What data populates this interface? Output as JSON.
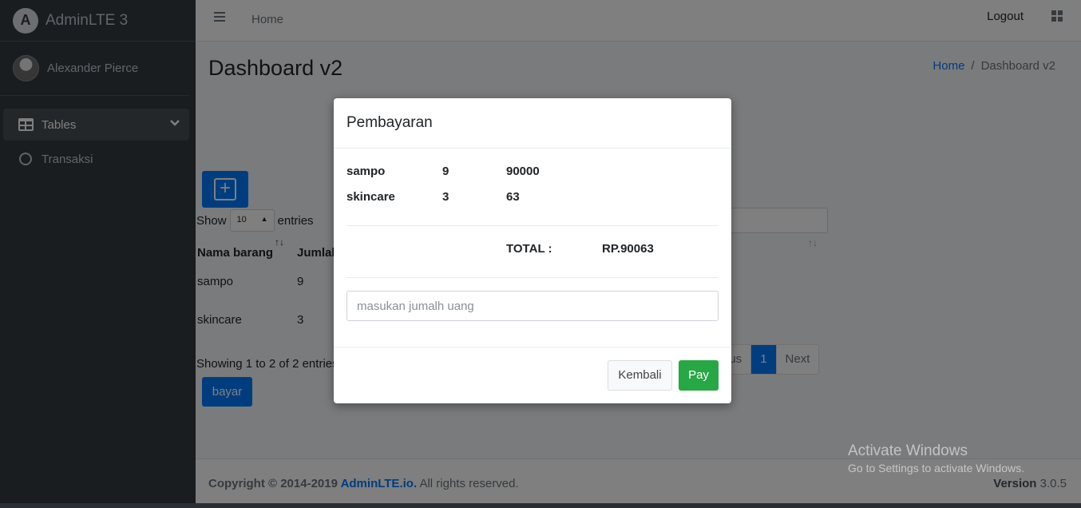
{
  "brand": {
    "title": "AdminLTE 3",
    "logo_letter": "A"
  },
  "user": {
    "name": "Alexander Pierce"
  },
  "sidebar": {
    "items": [
      {
        "label": "Tables",
        "icon": "table-icon",
        "active": true
      },
      {
        "label": "Transaksi",
        "icon": "circle-icon",
        "active": false
      }
    ]
  },
  "topbar": {
    "home": "Home",
    "logout": "Logout"
  },
  "page": {
    "title": "Dashboard v2"
  },
  "breadcrumb": {
    "home": "Home",
    "sep": "/",
    "current": "Dashboard v2"
  },
  "table": {
    "add_button": "+",
    "show_label": "Show",
    "entries_label": "entries",
    "page_size": "10",
    "columns": [
      "Nama barang",
      "Jumlah"
    ],
    "rows": [
      {
        "name": "sampo",
        "qty": "9"
      },
      {
        "name": "skincare",
        "qty": "3"
      }
    ],
    "showing_text": "Showing 1 to 2 of 2 entries",
    "pager": {
      "prev": "ous",
      "current": "1",
      "next": "Next"
    },
    "bayar_button": "bayar"
  },
  "footer": {
    "copy_prefix": "Copyright © 2014-2019 ",
    "copy_link": "AdminLTE.io.",
    "copy_suffix": " All rights reserved.",
    "version_label": "Version",
    "version_value": " 3.0.5"
  },
  "modal": {
    "title": "Pembayaran",
    "items": [
      {
        "name": "sampo",
        "qty": "9",
        "price": "90000"
      },
      {
        "name": "skincare",
        "qty": "3",
        "price": "63"
      }
    ],
    "total_label": "TOTAL :",
    "total_value": "RP.90063",
    "input_placeholder": "masukan jumalh uang",
    "cancel_button": "Kembali",
    "pay_button": "Pay"
  },
  "watermark": {
    "line1": "Activate Windows",
    "line2": "Go to Settings to activate Windows."
  }
}
